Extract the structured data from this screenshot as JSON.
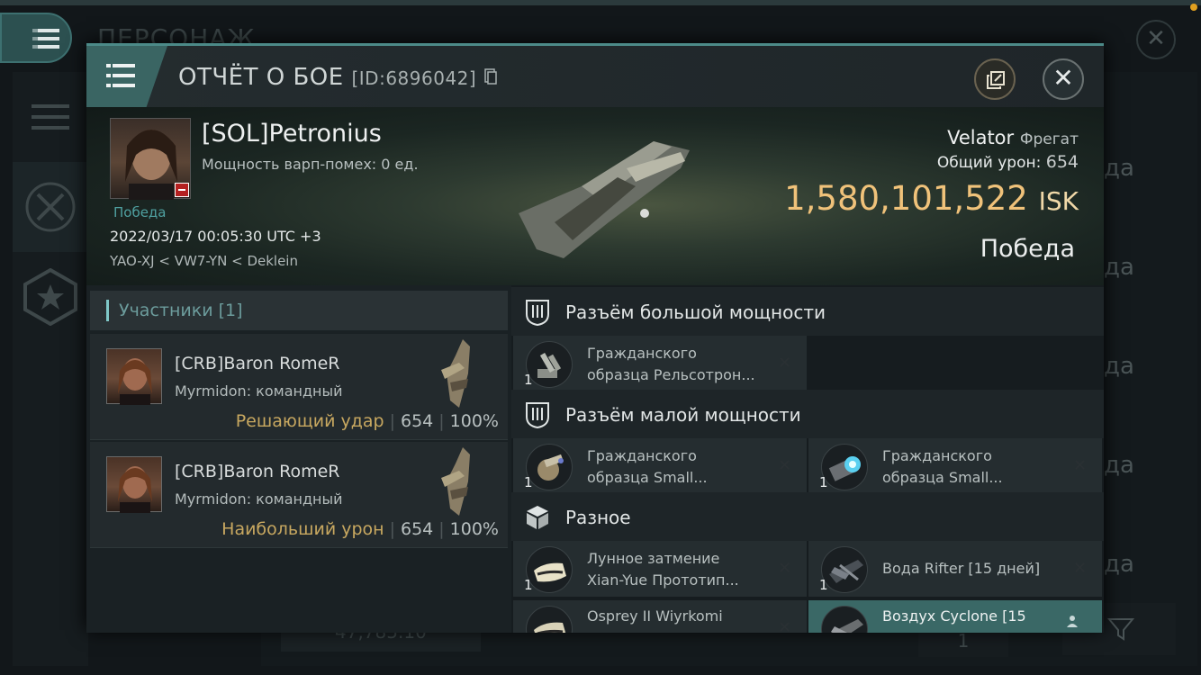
{
  "background": {
    "page_title": "ПЕРСОНАЖ",
    "row_labels": [
      "да",
      "да",
      "да",
      "да",
      "да"
    ],
    "bottom_input_value": "47,785.10",
    "page_number": "1"
  },
  "header": {
    "title": "ОТЧЁТ О БОЕ",
    "report_id": "[ID:6896042]"
  },
  "victim": {
    "name": "[SOL]Petronius",
    "warp_scramble": "Мощность варп-помех: 0 ед.",
    "outcome_small": "Победа",
    "datetime": "2022/03/17 00:05:30 UTC +3",
    "location": "YAO-XJ < VW7-YN < Deklein",
    "ship": "Velator",
    "ship_class": "Фрегат",
    "damage_label": "Общий урон:",
    "damage_value": "654",
    "isk_value": "1,580,101,522",
    "isk_unit": "ISK",
    "result": "Победа"
  },
  "participants": {
    "header": "Участники [1]",
    "rows": [
      {
        "name": "[CRB]Baron RomeR",
        "ship": "Myrmidon: командный",
        "role": "Решающий удар",
        "damage": "654",
        "percent": "100%"
      },
      {
        "name": "[CRB]Baron RomeR",
        "ship": "Myrmidon: командный",
        "role": "Наибольший урон",
        "damage": "654",
        "percent": "100%"
      }
    ]
  },
  "modules": {
    "high_slot": {
      "title": "Разъём большой мощности",
      "items": [
        {
          "line1": "Гражданского",
          "line2": "образца Рельсотрон...",
          "qty": "1",
          "icon": "railgun-icon"
        }
      ]
    },
    "low_slot": {
      "title": "Разъём малой мощности",
      "items": [
        {
          "line1": "Гражданского",
          "line2": "образца Small...",
          "qty": "1",
          "icon": "armor-repairer-icon"
        },
        {
          "line1": "Гражданского",
          "line2": "образца Small...",
          "qty": "1",
          "icon": "shield-booster-icon"
        }
      ]
    },
    "misc": {
      "title": "Разное",
      "items": [
        {
          "line1": "Лунное затмение",
          "line2": "Xian-Yue Прототип...",
          "qty": "1",
          "icon": "skin-icon"
        },
        {
          "text": "Вода  Rifter [15 дней]",
          "qty": "1",
          "icon": "ship-skin-icon"
        },
        {
          "text": "Osprey II Wiyrkomi",
          "icon": "skin-icon"
        },
        {
          "text": "Воздух Cyclone [15",
          "icon": "ship-skin-icon"
        }
      ]
    }
  },
  "colors": {
    "accent": "#4c8a88",
    "isk": "#f0c27a",
    "role_label": "#c8a860"
  }
}
